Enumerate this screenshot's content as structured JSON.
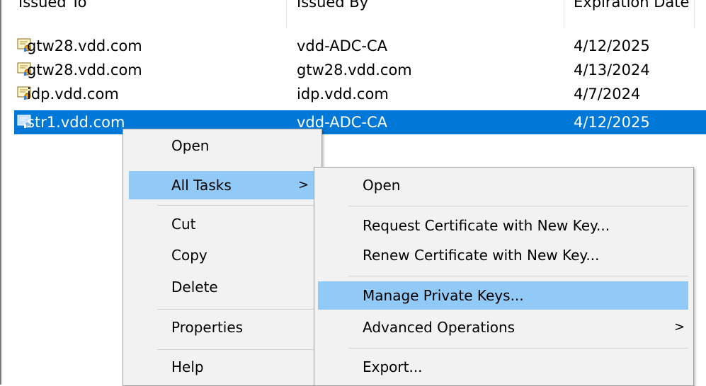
{
  "columns": {
    "issued_to": "Issued To",
    "issued_by": "Issued By",
    "expiration": "Expiration Date"
  },
  "rows": [
    {
      "issued_to": "gtw28.vdd.com",
      "issued_by": "vdd-ADC-CA",
      "expiration": "4/12/2025",
      "icon": "certificate-icon",
      "selected": false
    },
    {
      "issued_to": "gtw28.vdd.com",
      "issued_by": "gtw28.vdd.com",
      "expiration": "4/13/2024",
      "icon": "certificate-icon",
      "selected": false
    },
    {
      "issued_to": "idp.vdd.com",
      "issued_by": "idp.vdd.com",
      "expiration": "4/7/2024",
      "icon": "certificate-icon",
      "selected": false
    },
    {
      "issued_to": "str1.vdd.com",
      "issued_by": "vdd-ADC-CA",
      "expiration": "4/12/2025",
      "icon": "certificate-icon",
      "selected": true
    }
  ],
  "context_menu": {
    "open": "Open",
    "all_tasks": "All Tasks",
    "cut": "Cut",
    "copy": "Copy",
    "delete": "Delete",
    "properties": "Properties",
    "help": "Help",
    "submenu_arrow": ">"
  },
  "submenu": {
    "open": "Open",
    "request_new_key": "Request Certificate with New Key...",
    "renew_new_key": "Renew Certificate with New Key...",
    "manage_private_keys": "Manage Private Keys...",
    "advanced_operations": "Advanced Operations",
    "export": "Export...",
    "submenu_arrow": ">"
  },
  "colors": {
    "selection": "#0078d7",
    "menu_highlight": "#91c9f7",
    "menu_background": "#f2f2f2"
  }
}
